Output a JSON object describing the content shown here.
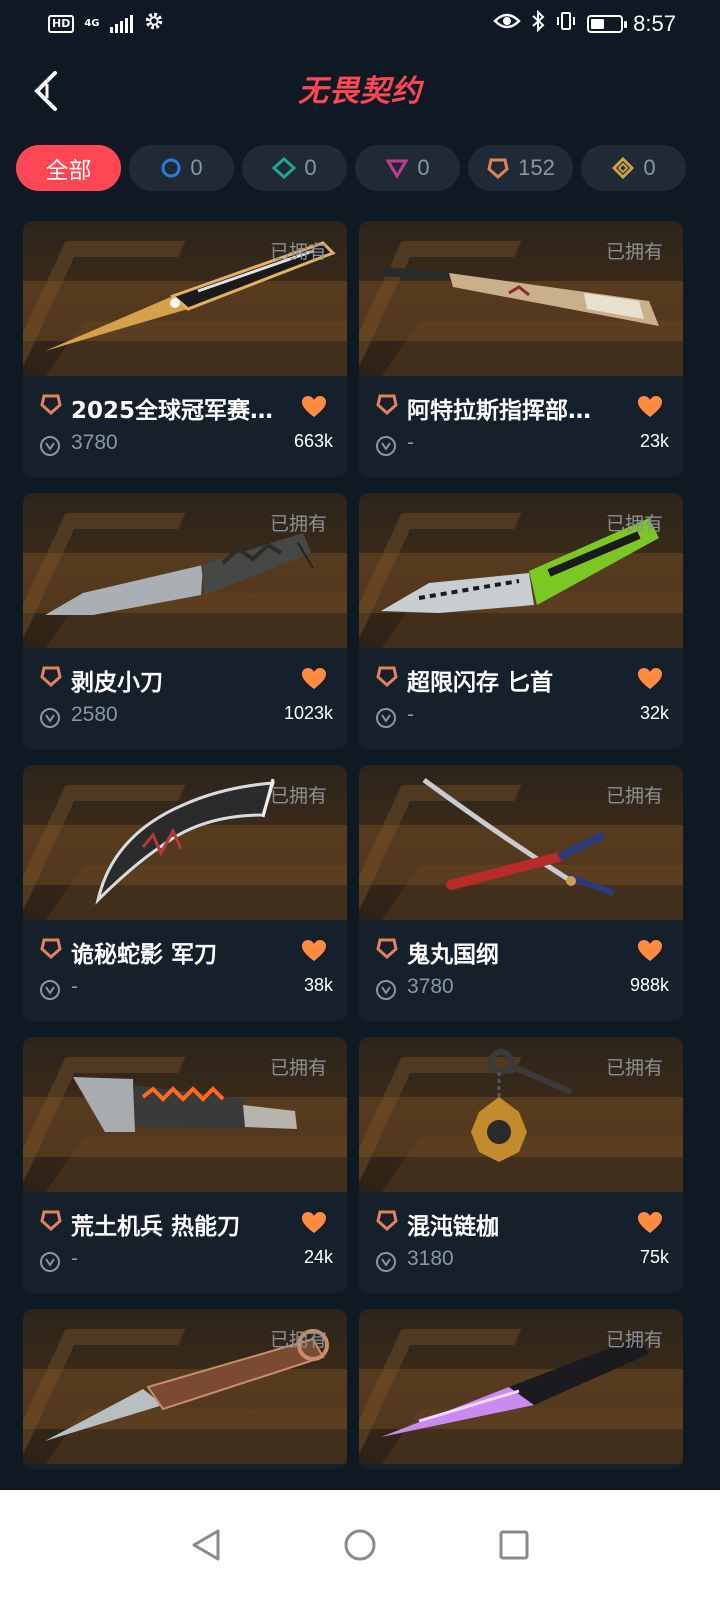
{
  "status_bar": {
    "hd": "HD",
    "network": "4G",
    "time": "8:57",
    "battery_level": 0.45
  },
  "header": {
    "title": "无畏契约"
  },
  "filters": [
    {
      "label": "全部",
      "active": true,
      "icon": ""
    },
    {
      "label": "0",
      "active": false,
      "icon": "circle-tier-icon",
      "color": "#2b7bd8"
    },
    {
      "label": "0",
      "active": false,
      "icon": "diamond-tier-icon",
      "color": "#1fa890"
    },
    {
      "label": "0",
      "active": false,
      "icon": "triangle-tier-icon",
      "color": "#c2398d"
    },
    {
      "label": "152",
      "active": false,
      "icon": "pentagon-tier-icon",
      "color": "#e2825a"
    },
    {
      "label": "0",
      "active": false,
      "icon": "rhombus-tier-icon",
      "color": "#c9a24b"
    }
  ],
  "owned_label": "已拥有",
  "items": [
    {
      "name": "2025全球冠军赛…",
      "price": "3780",
      "likes": "663k"
    },
    {
      "name": "阿特拉斯指挥部…",
      "price": "-",
      "likes": "23k"
    },
    {
      "name": "剥皮小刀",
      "price": "2580",
      "likes": "1023k"
    },
    {
      "name": "超限闪存 匕首",
      "price": "-",
      "likes": "32k"
    },
    {
      "name": "诡秘蛇影 军刀",
      "price": "-",
      "likes": "38k"
    },
    {
      "name": "鬼丸国纲",
      "price": "3780",
      "likes": "988k"
    },
    {
      "name": "荒土机兵 热能刀",
      "price": "-",
      "likes": "24k"
    },
    {
      "name": "混沌链枷",
      "price": "3180",
      "likes": "75k"
    }
  ],
  "colors": {
    "accent": "#ff4655",
    "heart": "#ff8a3d",
    "tier": "#e2825a"
  }
}
